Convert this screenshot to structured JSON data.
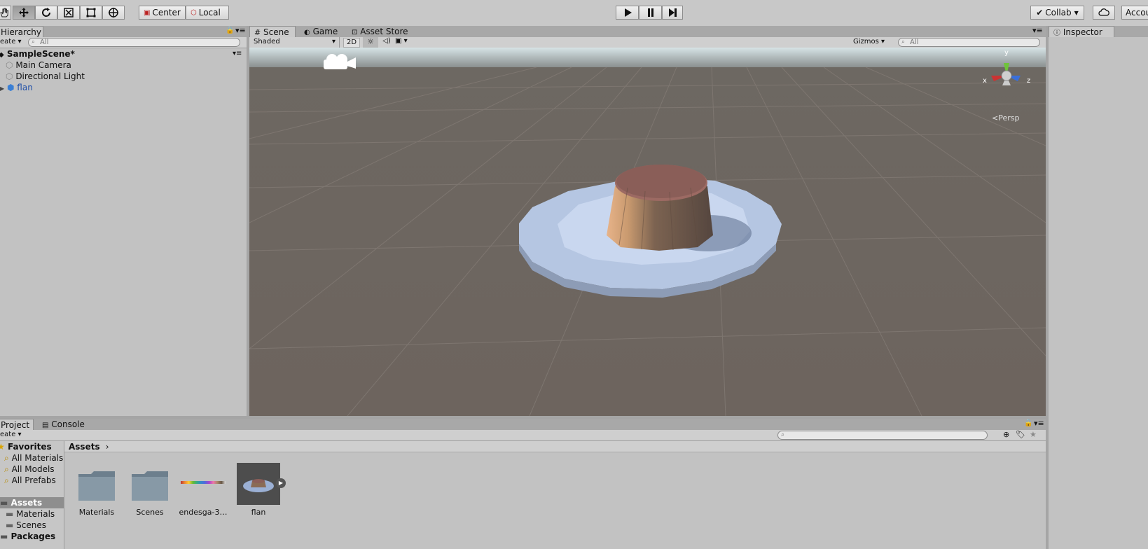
{
  "toolbar": {
    "tools": [
      "hand-tool",
      "move-tool",
      "rotate-tool",
      "scale-tool",
      "rect-tool",
      "transform-tool"
    ],
    "pivot_label": "Center",
    "space_label": "Local",
    "collab_label": "Collab",
    "account_label": "Accou"
  },
  "hierarchy": {
    "tab": "Hierarchy",
    "create_label": "eate",
    "search_placeholder": "All",
    "scene_name": "SampleScene*",
    "items": [
      "Main Camera",
      "Directional Light",
      "flan"
    ]
  },
  "scene": {
    "tabs": [
      "Scene",
      "Game",
      "Asset Store"
    ],
    "shading_mode": "Shaded",
    "mode_2d": "2D",
    "gizmos_label": "Gizmos",
    "search_placeholder": "All",
    "axis_y": "y",
    "axis_x": "x",
    "axis_z": "z",
    "projection_label": "Persp"
  },
  "inspector": {
    "tab": "Inspector"
  },
  "project": {
    "tabs": [
      "Project",
      "Console"
    ],
    "create_label": "eate",
    "favorites_label": "Favorites",
    "favorites": [
      "All Materials",
      "All Models",
      "All Prefabs"
    ],
    "assets_label": "Assets",
    "asset_folders": [
      "Materials",
      "Scenes"
    ],
    "packages_label": "Packages",
    "breadcrumb": "Assets",
    "items": [
      "Materials",
      "Scenes",
      "endesga-3…",
      "flan"
    ]
  },
  "colors": {
    "bg": "#c2c2c2",
    "scene_ground": "#6e6660",
    "accent_blue": "#2b5fb8"
  }
}
